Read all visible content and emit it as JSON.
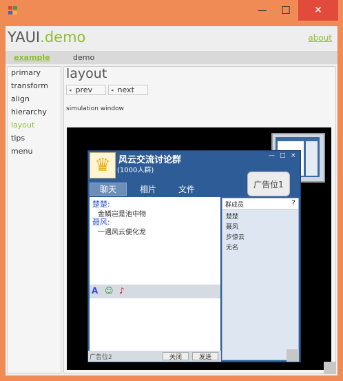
{
  "window": {
    "controls": {
      "minimize": "—",
      "maximize": "☐",
      "close": "✕"
    }
  },
  "header": {
    "brand_prefix": "YAUI",
    "brand_suffix": ".demo",
    "about_label": "about"
  },
  "menu": {
    "items": [
      {
        "label": "example",
        "active": true
      },
      {
        "label": "demo",
        "active": false
      }
    ]
  },
  "sidebar": {
    "items": [
      {
        "label": "primary"
      },
      {
        "label": "transform"
      },
      {
        "label": "align"
      },
      {
        "label": "hierarchy"
      },
      {
        "label": "layout",
        "active": true
      },
      {
        "label": "tips"
      },
      {
        "label": "menu"
      }
    ]
  },
  "main": {
    "title": "layout",
    "prev_label": "prev",
    "next_label": "next",
    "sim_label": "simulation window"
  },
  "chat_window": {
    "title": "风云交流讨论群",
    "subtitle": "(1000人群)",
    "controls": {
      "minimize": "—",
      "maximize": "□",
      "close": "×"
    },
    "tabs": [
      {
        "label": "聊天",
        "active": true
      },
      {
        "label": "相片",
        "active": false
      },
      {
        "label": "文件",
        "active": false
      }
    ],
    "ad_top": "广告位1",
    "messages": [
      {
        "name": "楚楚:",
        "text": "金鳞岂是池中物"
      },
      {
        "name": "聂风:",
        "text": "一遇风云便化龙"
      }
    ],
    "toolbar": {
      "font": "A",
      "emoji": "☺",
      "music": "♪"
    },
    "ad_bottom": "广告位2",
    "close_label": "关闭",
    "send_label": "发送",
    "members_title": "群成员",
    "members_help": "?",
    "members": [
      "楚楚",
      "聂风",
      "步惊云",
      "无名"
    ]
  },
  "colors": {
    "accent": "#8fbe2f",
    "window_frame": "#f08b56",
    "close_button": "#e14b3c",
    "chat_blue": "#2e5c97"
  }
}
